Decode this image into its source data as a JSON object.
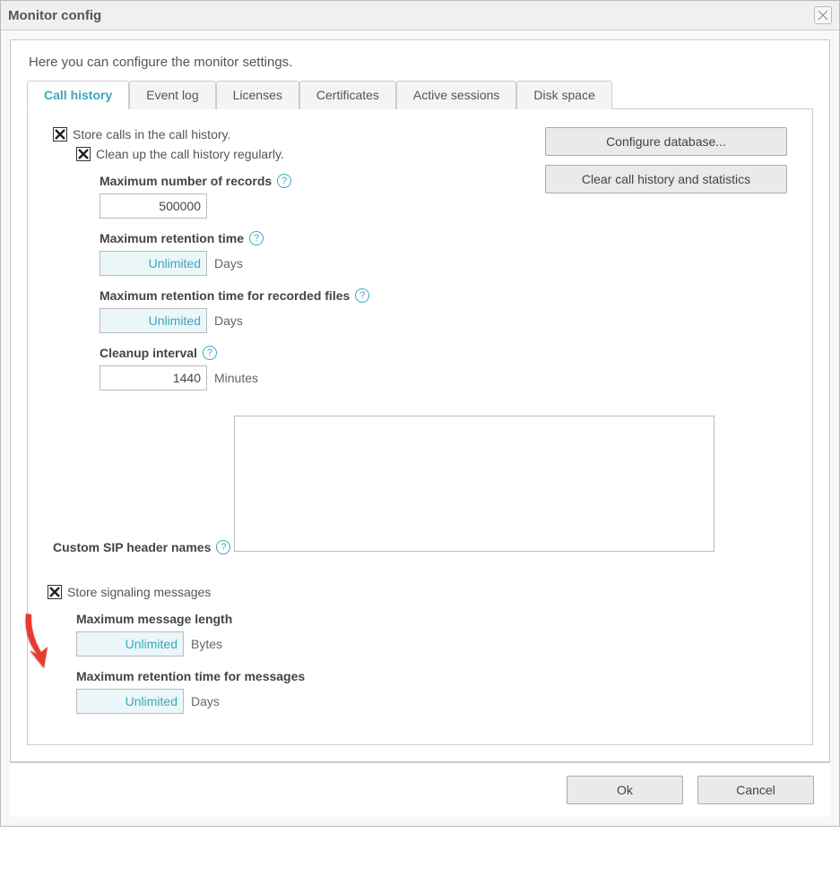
{
  "window": {
    "title": "Monitor config"
  },
  "intro": "Here you can configure the monitor settings.",
  "tabs": [
    {
      "label": "Call history",
      "active": true
    },
    {
      "label": "Event log",
      "active": false
    },
    {
      "label": "Licenses",
      "active": false
    },
    {
      "label": "Certificates",
      "active": false
    },
    {
      "label": "Active sessions",
      "active": false
    },
    {
      "label": "Disk space",
      "active": false
    }
  ],
  "sideButtons": {
    "configDb": "Configure database...",
    "clearHistory": "Clear call history and statistics"
  },
  "checks": {
    "storeCalls": "Store calls in the call history.",
    "cleanUp": "Clean up the call history regularly.",
    "storeSignaling": "Store signaling messages"
  },
  "fields": {
    "maxRecords": {
      "label": "Maximum number of records",
      "value": "500000",
      "unit": ""
    },
    "maxRetention": {
      "label": "Maximum retention time",
      "value": "Unlimited",
      "unit": "Days"
    },
    "maxRetentionRec": {
      "label": "Maximum retention time for recorded files",
      "value": "Unlimited",
      "unit": "Days"
    },
    "cleanupInterval": {
      "label": "Cleanup interval",
      "value": "1440",
      "unit": "Minutes"
    },
    "sipHeaders": {
      "label": "Custom SIP header names",
      "value": ""
    },
    "maxMsgLen": {
      "label": "Maximum message length",
      "value": "Unlimited",
      "unit": "Bytes"
    },
    "maxMsgRetention": {
      "label": "Maximum retention time for messages",
      "value": "Unlimited",
      "unit": "Days"
    }
  },
  "footer": {
    "ok": "Ok",
    "cancel": "Cancel"
  }
}
